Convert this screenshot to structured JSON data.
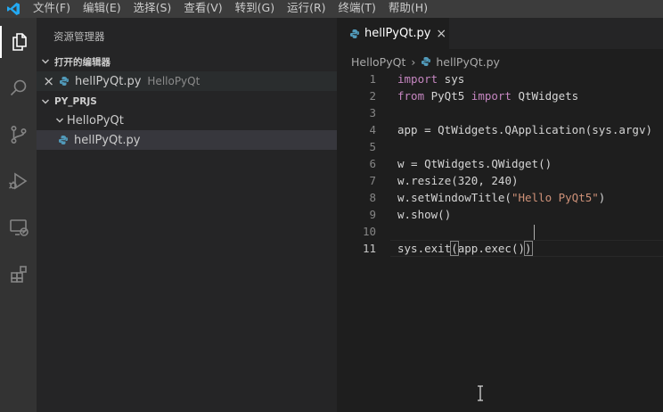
{
  "menu": [
    "文件(F)",
    "编辑(E)",
    "选择(S)",
    "查看(V)",
    "转到(G)",
    "运行(R)",
    "终端(T)",
    "帮助(H)"
  ],
  "activity": [
    {
      "name": "explorer-icon",
      "active": true
    },
    {
      "name": "search-icon",
      "active": false
    },
    {
      "name": "source-control-icon",
      "active": false
    },
    {
      "name": "run-debug-icon",
      "active": false
    },
    {
      "name": "remote-explorer-icon",
      "active": false
    },
    {
      "name": "extensions-icon",
      "active": false
    }
  ],
  "sidebar": {
    "title": "资源管理器",
    "open_editors": {
      "header": "打开的编辑器",
      "items": [
        {
          "close": "×",
          "label": "hellPyQt.py",
          "description": "HelloPyQt"
        }
      ]
    },
    "workspace": {
      "header": "PY_PRJS",
      "folder": "HelloPyQt",
      "file": "hellPyQt.py"
    }
  },
  "editor": {
    "tab": {
      "label": "hellPyQt.py",
      "close": "×"
    },
    "breadcrumb": {
      "folder": "HelloPyQt",
      "separator": "›",
      "file": "hellPyQt.py"
    },
    "line_numbers": [
      "1",
      "2",
      "3",
      "4",
      "5",
      "6",
      "7",
      "8",
      "9",
      "10",
      "11"
    ],
    "active_line": "11",
    "code": {
      "l1": {
        "kw": "import",
        "name": " sys"
      },
      "l2": {
        "kw1": "from",
        "mod": " PyQt5 ",
        "kw2": "import",
        "cls": " QtWidgets"
      },
      "l4": {
        "var": "app",
        "op": " = ",
        "obj": "QtWidgets.",
        "fn": "QApplication",
        "args": "(sys.argv)"
      },
      "l6": {
        "var": "w",
        "op": " = ",
        "obj": "QtWidgets.",
        "fn": "QWidget",
        "args": "()"
      },
      "l7": {
        "obj": "w.",
        "fn": "resize",
        "p1": "(",
        "n1": "320",
        "comma": ", ",
        "n2": "240",
        "p2": ")"
      },
      "l8": {
        "obj": "w.",
        "fn": "setWindowTitle",
        "p1": "(",
        "str": "\"Hello PyQt5\"",
        "p2": ")"
      },
      "l9": {
        "obj": "w.",
        "fn": "show",
        "args": "()"
      },
      "l11": {
        "obj": "sys.",
        "fn": "exit",
        "p1": "(",
        "obj2": "app.",
        "fn2": "exec",
        "args": "()",
        "p2": ")"
      }
    }
  },
  "colors": {
    "accent": "#0078d4",
    "python_icon": "#519aba"
  }
}
